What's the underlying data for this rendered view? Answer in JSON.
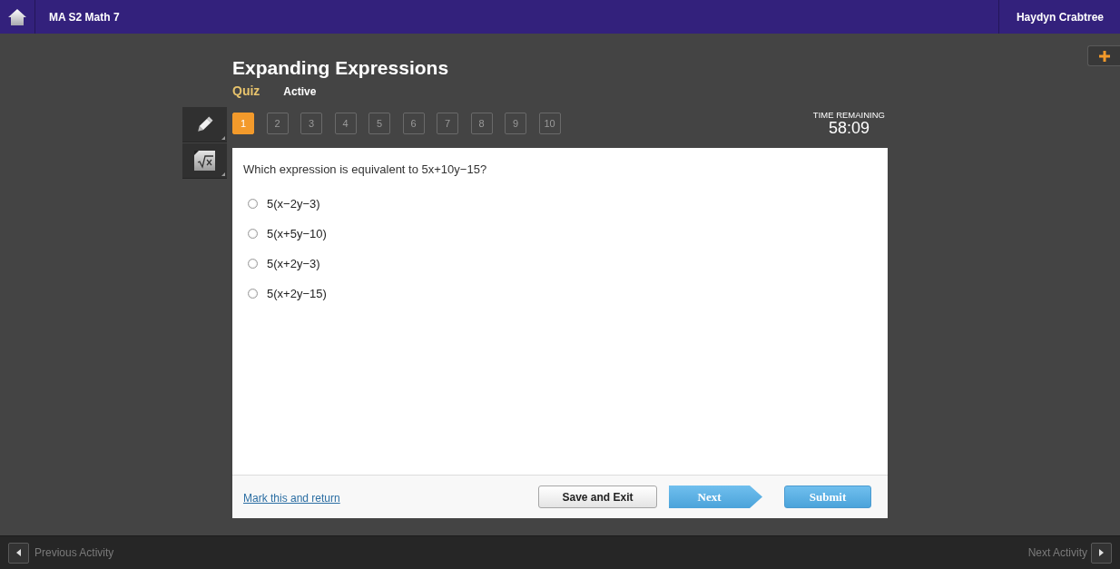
{
  "header": {
    "course_title": "MA S2 Math 7",
    "user_name": "Haydyn Crabtree"
  },
  "activity": {
    "title": "Expanding Expressions",
    "type": "Quiz",
    "status": "Active"
  },
  "question_nav": [
    {
      "label": "1",
      "selected": true
    },
    {
      "label": "2",
      "selected": false
    },
    {
      "label": "3",
      "selected": false
    },
    {
      "label": "4",
      "selected": false
    },
    {
      "label": "5",
      "selected": false
    },
    {
      "label": "6",
      "selected": false
    },
    {
      "label": "7",
      "selected": false
    },
    {
      "label": "8",
      "selected": false
    },
    {
      "label": "9",
      "selected": false
    },
    {
      "label": "10",
      "selected": false
    }
  ],
  "timer": {
    "label": "TIME REMAINING",
    "value": "58:09"
  },
  "question": {
    "prompt": "Which expression is equivalent to 5x+10y−15?",
    "options": [
      {
        "text": "5(x−2y−3)",
        "selected": false
      },
      {
        "text": "5(x+5y−10)",
        "selected": false
      },
      {
        "text": "5(x+2y−3)",
        "selected": false
      },
      {
        "text": "5(x+2y−15)",
        "selected": false
      }
    ]
  },
  "footer": {
    "link": "Mark this and return",
    "buttons": [
      {
        "label": "Save and Exit",
        "kind": "secondary"
      },
      {
        "label": "Next",
        "kind": "next"
      },
      {
        "label": "Submit",
        "kind": "primary"
      }
    ]
  },
  "activity_nav": {
    "previous": "Previous Activity",
    "next": "Next Activity"
  }
}
